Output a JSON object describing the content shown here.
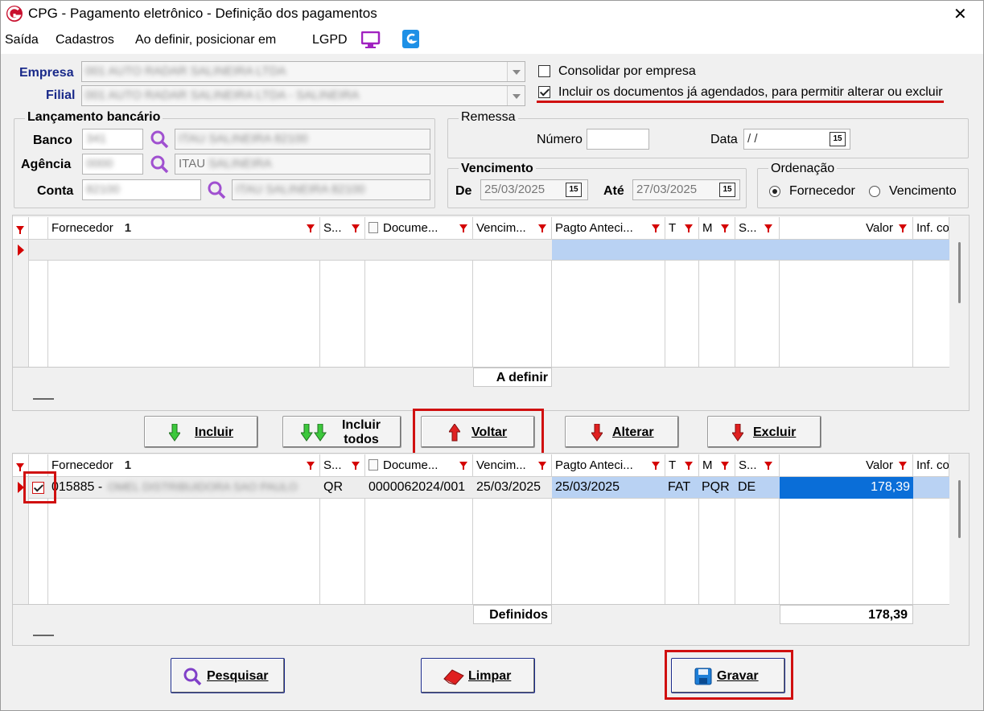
{
  "window": {
    "title": "CPG - Pagamento eletrônico - Definição dos pagamentos",
    "close_glyph": "✕"
  },
  "menu": {
    "items": [
      "Saída",
      "Cadastros",
      "Ao definir, posicionar em",
      "LGPD"
    ]
  },
  "filters": {
    "empresa_label": "Empresa",
    "empresa_value": "001 AUTO RADAR SALINEIRA LTDA",
    "filial_label": "Filial",
    "filial_value": "001 AUTO RADAR SALINEIRA LTDA - SALINEIRA",
    "consolidar_label": "Consolidar por empresa",
    "incluir_label": "Incluir os documentos já agendados, para permitir alterar ou excluir"
  },
  "lancamento": {
    "title": "Lançamento bancário",
    "banco_label": "Banco",
    "banco_code": "341",
    "banco_desc": "ITAU SALINEIRA 82100",
    "agencia_label": "Agência",
    "agencia_code": "0000",
    "agencia_desc_prefix": "ITAU",
    "agencia_desc_rest": "SALINEIRA",
    "conta_label": "Conta",
    "conta_code": "82100",
    "conta_desc": "ITAU SALINEIRA 82100"
  },
  "remessa": {
    "title": "Remessa",
    "numero_label": "Número",
    "numero_value": "",
    "data_label": "Data",
    "data_value": " / /",
    "cal_label": "15"
  },
  "vencimento": {
    "title": "Vencimento",
    "de_label": "De",
    "de_value": "25/03/2025",
    "ate_label": "Até",
    "ate_value": "27/03/2025",
    "cal_label": "15"
  },
  "ordenacao": {
    "title": "Ordenação",
    "opt1": "Fornecedor",
    "opt2": "Vencimento",
    "selected": "Fornecedor"
  },
  "grid_columns": [
    "Fornecedor",
    "S...",
    "Docume...",
    "Vencim...",
    "Pagto Anteci...",
    "T",
    "M",
    "S...",
    "Valor",
    "Inf. co"
  ],
  "sort_marker": "1",
  "grid_top": {
    "footer_label": "A definir"
  },
  "actions": {
    "incluir": "Incluir",
    "incluir_todos_line1": "Incluir",
    "incluir_todos_line2": "todos",
    "voltar": "Voltar",
    "alterar": "Alterar",
    "excluir": "Excluir"
  },
  "grid_bottom": {
    "row": {
      "checked": true,
      "fornecedor_code": "015885 -",
      "fornecedor_name": "OMEL DISTRIBUIDORA SAO PAULO",
      "s": "QR",
      "documento": "0000062024/001",
      "vencimento": "25/03/2025",
      "pagto_antecipado": "25/03/2025",
      "t": "FAT",
      "m": "PQR",
      "s2": "DE",
      "valor": "178,39"
    },
    "footer_label": "Definidos",
    "footer_total": "178,39"
  },
  "bottom_buttons": {
    "pesquisar": "Pesquisar",
    "limpar": "Limpar",
    "gravar": "Gravar"
  },
  "colors": {
    "accent_red": "#d01010",
    "selection_blue": "#0a6ed8",
    "row_highlight": "#b9d2f3",
    "label_blue": "#1a2a8a"
  }
}
